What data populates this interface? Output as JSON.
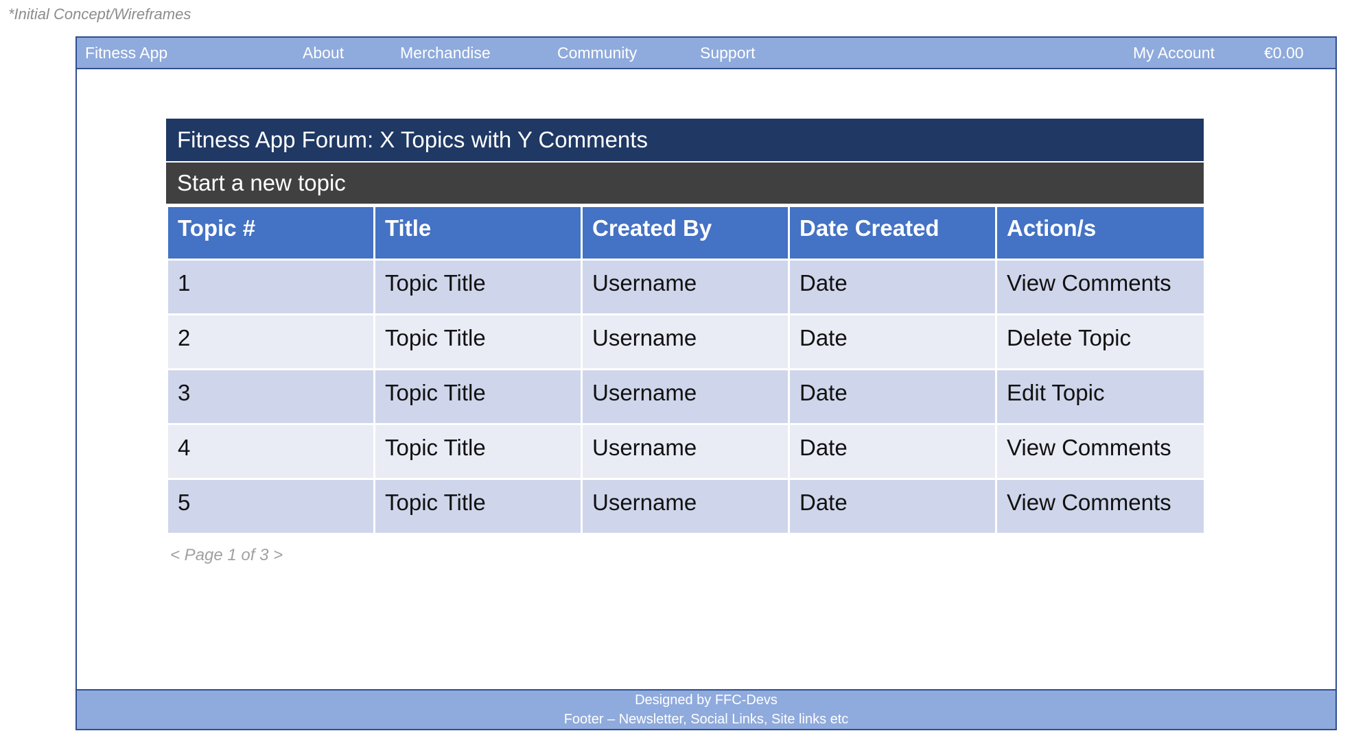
{
  "note": "*Initial Concept/Wireframes",
  "nav": {
    "brand": "Fitness App",
    "items": [
      "About",
      "Merchandise",
      "Community",
      "Support"
    ],
    "account": "My Account",
    "cart": "€0.00"
  },
  "forum": {
    "title": "Fitness App Forum: X Topics with Y Comments",
    "new_topic": "Start a new topic",
    "columns": [
      "Topic #",
      "Title",
      "Created By",
      "Date Created",
      "Action/s"
    ],
    "rows": [
      {
        "num": "1",
        "title": "Topic Title",
        "user": "Username",
        "date": "Date",
        "action": "View Comments"
      },
      {
        "num": "2",
        "title": "Topic Title",
        "user": "Username",
        "date": "Date",
        "action": "Delete Topic"
      },
      {
        "num": "3",
        "title": "Topic Title",
        "user": "Username",
        "date": "Date",
        "action": "Edit Topic"
      },
      {
        "num": "4",
        "title": "Topic Title",
        "user": "Username",
        "date": "Date",
        "action": "View Comments"
      },
      {
        "num": "5",
        "title": "Topic Title",
        "user": "Username",
        "date": "Date",
        "action": "View Comments"
      }
    ],
    "pager": "< Page 1 of 3 >"
  },
  "footer": {
    "line1": "Designed by FFC-Devs",
    "line2": "Footer – Newsletter, Social Links, Site links etc"
  },
  "colors": {
    "nav_bg": "#8faadc",
    "title_bg": "#1f3864",
    "new_topic_bg": "#404040",
    "header_bg": "#4472c4",
    "row_odd": "#cfd5ea",
    "row_even": "#e9ebf5"
  }
}
